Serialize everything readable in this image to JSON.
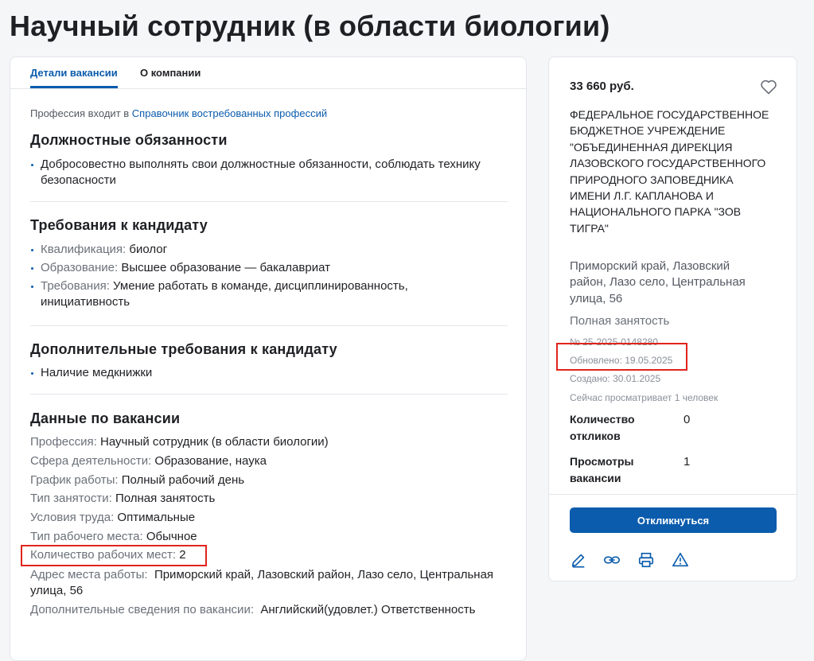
{
  "page": {
    "title": "Научный сотрудник (в области биологии)"
  },
  "tabs": [
    {
      "label": "Детали вакансии",
      "active": true
    },
    {
      "label": "О компании",
      "active": false
    }
  ],
  "profession_note": {
    "prefix": "Профессия входит в",
    "link": "Справочник востребованных профессий"
  },
  "duties": {
    "heading": "Должностные обязанности",
    "items": [
      "Добросовестно выполнять свои должностные обязанности, соблюдать технику безопасности"
    ]
  },
  "requirements": {
    "heading": "Требования к кандидату",
    "items": [
      {
        "label": "Квалификация:",
        "value": "биолог"
      },
      {
        "label": "Образование:",
        "value": "Высшее образование — бакалавриат"
      },
      {
        "label": "Требования:",
        "value": "Умение работать в команде, дисциплинированность, инициативность"
      }
    ]
  },
  "extra_requirements": {
    "heading": "Дополнительные требования к кандидату",
    "items": [
      "Наличие медкнижки"
    ]
  },
  "vacancy_data": {
    "heading": "Данные по вакансии",
    "rows": [
      {
        "label": "Профессия:",
        "value": "Научный сотрудник (в области биологии)"
      },
      {
        "label": "Сфера деятельности:",
        "value": "Образование, наука"
      },
      {
        "label": "График работы:",
        "value": "Полный рабочий день"
      },
      {
        "label": "Тип занятости:",
        "value": "Полная занятость"
      },
      {
        "label": "Условия труда:",
        "value": "Оптимальные"
      },
      {
        "label": "Тип рабочего места:",
        "value": "Обычное"
      },
      {
        "label": "Количество рабочих мест:",
        "value": "2"
      },
      {
        "label": "Адрес места работы:",
        "value": "Приморский край, Лазовский район, Лазо село, Центральная улица, 56"
      },
      {
        "label": "Дополнительные сведения по вакансии:",
        "value": "Английский(удовлет.) Ответственность"
      }
    ]
  },
  "sidebar": {
    "salary": "33 660 руб.",
    "company": "ФЕДЕРАЛЬНОЕ ГОСУДАРСТВЕННОЕ БЮДЖЕТНОЕ УЧРЕЖДЕНИЕ \"ОБЪЕДИНЕННАЯ ДИРЕКЦИЯ ЛАЗОВСКОГО ГОСУДАРСТВЕННОГО ПРИРОДНОГО ЗАПОВЕДНИКА ИМЕНИ Л.Г. КАПЛАНОВА И НАЦИОНАЛЬНОГО ПАРКА \"ЗОВ ТИГРА\"",
    "address": "Приморский край, Лазовский район, Лазо село, Центральная улица, 56",
    "employment": "Полная занятость",
    "number": "№ 25-2025-0148280",
    "updated": "Обновлено: 19.05.2025",
    "created": "Создано: 30.01.2025",
    "viewing_now": "Сейчас просматривает 1 человек",
    "responses_label": "Количество откликов",
    "responses_value": "0",
    "views_label": "Просмотры вакансии",
    "views_value": "1",
    "apply_label": "Откликнуться"
  },
  "colors": {
    "accent": "#0b5cad",
    "highlight": "#e0241b"
  }
}
